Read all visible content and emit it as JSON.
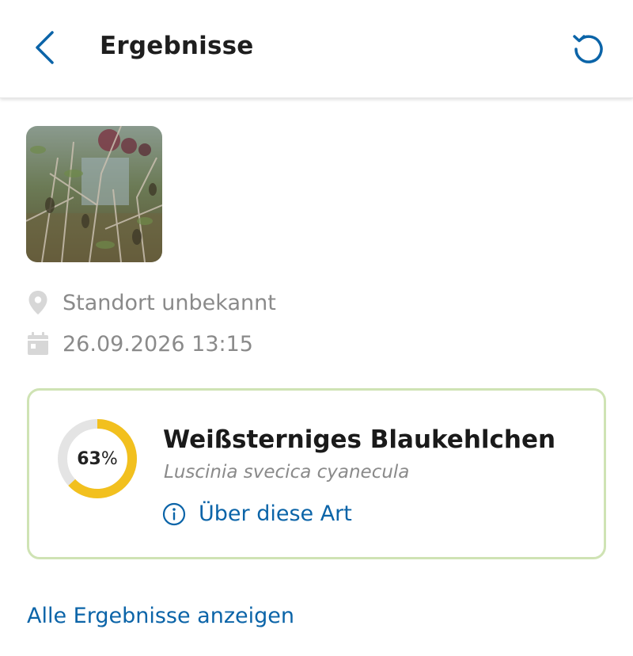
{
  "header": {
    "title": "Ergebnisse",
    "back_icon": "chevron-left-icon",
    "reset_icon": "reset-icon"
  },
  "observation": {
    "photo_alt": "Beobachtungsfoto",
    "location": "Standort unbekannt",
    "datetime": "26.09.2026 13:15",
    "location_icon": "map-pin-icon",
    "date_icon": "calendar-icon"
  },
  "result": {
    "score_value": "63",
    "score_unit": "%",
    "score_fraction": 0.63,
    "species_name": "Weißsterniges Blaukehlchen",
    "species_latin": "Luscinia svecica cyanecula",
    "about_label": "Über diese Art",
    "about_icon": "info-icon"
  },
  "footer": {
    "all_results_label": "Alle Ergebnisse anzeigen"
  },
  "colors": {
    "accent_blue": "#0b64a8",
    "ring_fill": "#f2c01e",
    "ring_track": "#e4e4e4",
    "card_border": "#cfe3b4",
    "muted_text": "#8a8a8a"
  }
}
